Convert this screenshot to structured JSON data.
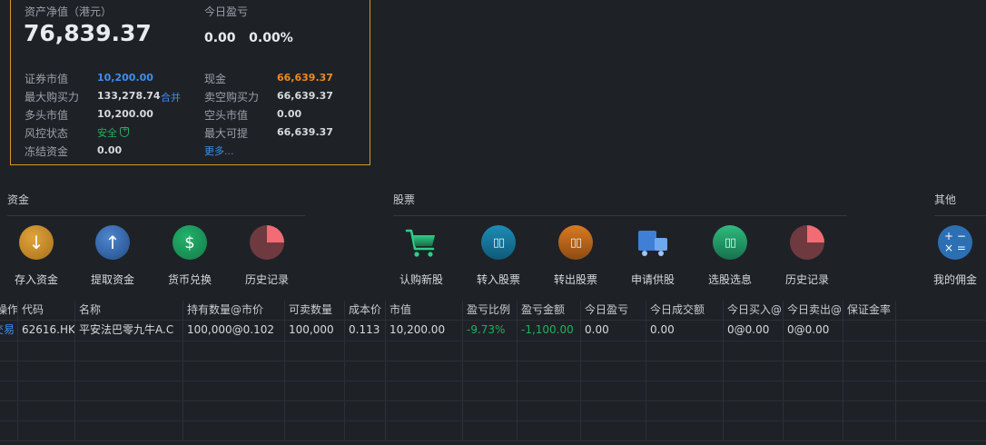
{
  "summary": {
    "net_assets_label": "资产净值（港元）",
    "net_assets_value": "76,839.37",
    "today_pl_label": "今日盈亏",
    "today_pl_value": "0.00   0.00%",
    "rows": [
      {
        "l1": "证券市值",
        "v1": "10,200.00",
        "l2": "现金",
        "v2": "66,639.37"
      },
      {
        "l1": "最大购买力",
        "v1": "133,278.74",
        "l2": "卖空购买力",
        "v2": "66,639.37"
      },
      {
        "l1": "多头市值",
        "v1": "10,200.00",
        "l2": "空头市值",
        "v2": "0.00"
      },
      {
        "l1": "风控状态",
        "v1": "安全",
        "l2": "最大可提",
        "v2": "66,639.37"
      },
      {
        "l1": "冻结资金",
        "v1": "0.00",
        "l2": "",
        "v2": ""
      }
    ],
    "merge_link": "合并",
    "more_link": "更多..."
  },
  "sections": {
    "funds": "资金",
    "stocks": "股票",
    "other": "其他"
  },
  "functions": {
    "deposit": "存入资金",
    "withdraw": "提取资金",
    "exchange": "货币兑换",
    "funds_history": "历史记录",
    "ipo": "认购新股",
    "transfer_in": "转入股票",
    "transfer_out": "转出股票",
    "supply": "申请供股",
    "picks": "选股选息",
    "stocks_history": "历史记录",
    "commission": "我的佣金"
  },
  "table": {
    "headers": [
      "操作",
      "代码",
      "名称",
      "持有数量@市价",
      "可卖数量",
      "成本价",
      "市值",
      "盈亏比例",
      "盈亏金额",
      "今日盈亏",
      "今日成交额",
      "今日买入@",
      "今日卖出@",
      "保证金率"
    ],
    "rows": [
      {
        "action": "交易",
        "code": "62616.HK",
        "name": "平安法巴零九牛A.C",
        "holding": "100,000@0.102",
        "sellable": "100,000",
        "cost": "0.113",
        "market_value": "10,200.00",
        "pl_ratio": "-9.73%",
        "pl_amount": "-1,100.00",
        "today_pl": "0.00",
        "today_turnover": "0.00",
        "today_buy": "0@0.00",
        "today_sell": "0@0.00",
        "margin": ""
      }
    ]
  },
  "colors": {
    "accent_border": "#d9962b",
    "link_blue": "#3d8ef0",
    "cash_orange": "#f08a1c",
    "gain_green": "#1fb15a"
  }
}
